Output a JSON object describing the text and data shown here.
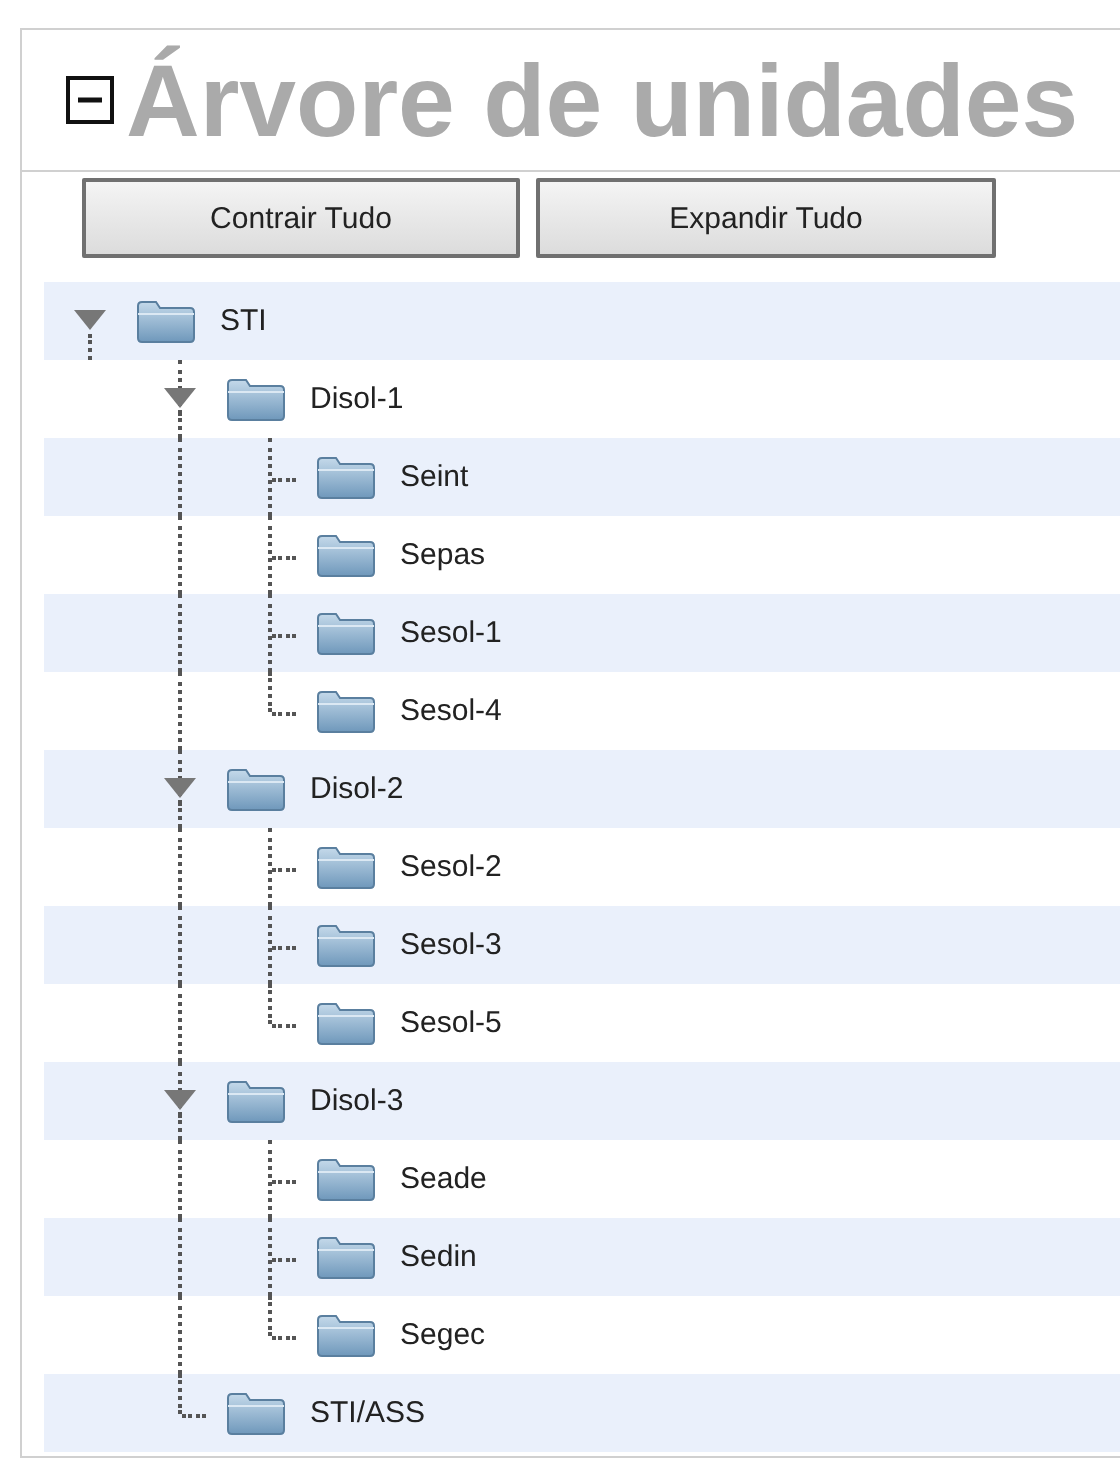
{
  "panel": {
    "title": "Árvore de unidades",
    "collapsed": false
  },
  "buttons": [
    "Contrair Tudo",
    "Expandir Tudo"
  ],
  "tree": [
    {
      "label": "STI",
      "expanded": true,
      "children": [
        {
          "label": "Disol-1",
          "expanded": true,
          "children": [
            {
              "label": "Seint"
            },
            {
              "label": "Sepas"
            },
            {
              "label": "Sesol-1"
            },
            {
              "label": "Sesol-4"
            }
          ]
        },
        {
          "label": "Disol-2",
          "expanded": true,
          "children": [
            {
              "label": "Sesol-2"
            },
            {
              "label": "Sesol-3"
            },
            {
              "label": "Sesol-5"
            }
          ]
        },
        {
          "label": "Disol-3",
          "expanded": true,
          "children": [
            {
              "label": "Seade"
            },
            {
              "label": "Sedin"
            },
            {
              "label": "Segec"
            }
          ]
        },
        {
          "label": "STI/ASS"
        }
      ]
    }
  ]
}
